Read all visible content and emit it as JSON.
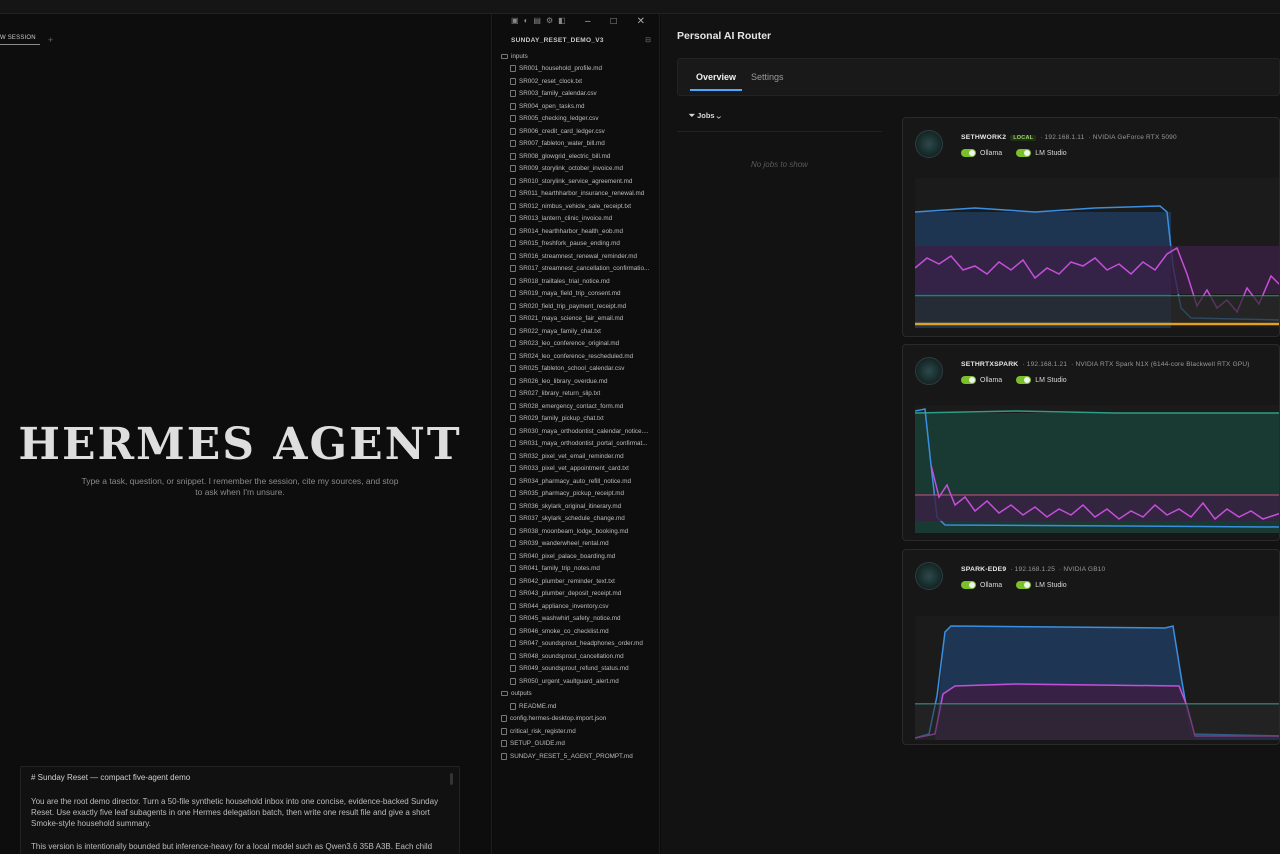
{
  "hermes": {
    "tab_label": "W SESSION",
    "tab_add": "+",
    "logo": "HERMES AGENT",
    "tagline": "Type a task, question, or snippet. I remember the session, cite my sources, and stop to ask when I'm unsure.",
    "prompt": {
      "heading": "# Sunday Reset — compact five-agent demo",
      "para1": "You are the root demo director. Turn a 50-file synthetic household inbox into one concise, evidence-backed Sunday Reset. Use exactly five leaf subagents in one Hermes delegation batch, then write one result file and give a short Smoke-style household summary.",
      "para2": "This version is intentionally bounded but inference-heavy for a local model such as Qwen3.6 35B A3B. Each child performs full"
    }
  },
  "explorer": {
    "title": "SUNDAY_RESET_DEMO_V3",
    "folder_inputs": "inputs",
    "input_files": [
      "SR001_household_profile.md",
      "SR002_reset_clock.txt",
      "SR003_family_calendar.csv",
      "SR004_open_tasks.md",
      "SR005_checking_ledger.csv",
      "SR006_credit_card_ledger.csv",
      "SR007_fableton_water_bill.md",
      "SR008_glowgrid_electric_bill.md",
      "SR009_storylink_october_invoice.md",
      "SR010_storylink_service_agreement.md",
      "SR011_hearthharbor_insurance_renewal.md",
      "SR012_nimbus_vehicle_sale_receipt.txt",
      "SR013_lantern_clinic_invoice.md",
      "SR014_hearthharbor_health_eob.md",
      "SR015_freshfork_pause_ending.md",
      "SR016_streamnest_renewal_reminder.md",
      "SR017_streamnest_cancellation_confirmatio...",
      "SR018_trailtales_trial_notice.md",
      "SR019_maya_field_trip_consent.md",
      "SR020_field_trip_payment_receipt.md",
      "SR021_maya_science_fair_email.md",
      "SR022_maya_family_chat.txt",
      "SR023_leo_conference_original.md",
      "SR024_leo_conference_rescheduled.md",
      "SR025_fableton_school_calendar.csv",
      "SR026_leo_library_overdue.md",
      "SR027_library_return_slip.txt",
      "SR028_emergency_contact_form.md",
      "SR029_family_pickup_chat.txt",
      "SR030_maya_orthodontist_calendar_notice....",
      "SR031_maya_orthodontist_portal_confirmat...",
      "SR032_pixel_vet_email_reminder.md",
      "SR033_pixel_vet_appointment_card.txt",
      "SR034_pharmacy_auto_refill_notice.md",
      "SR035_pharmacy_pickup_receipt.md",
      "SR036_skylark_original_itinerary.md",
      "SR037_skylark_schedule_change.md",
      "SR038_moonbeam_lodge_booking.md",
      "SR039_wanderwheel_rental.md",
      "SR040_pixel_palace_boarding.md",
      "SR041_family_trip_notes.md",
      "SR042_plumber_reminder_text.txt",
      "SR043_plumber_deposit_receipt.md",
      "SR044_appliance_inventory.csv",
      "SR045_washwhirl_safety_notice.md",
      "SR046_smoke_co_checklist.md",
      "SR047_soundsprout_headphones_order.md",
      "SR048_soundsprout_cancellation.md",
      "SR049_soundsprout_refund_status.md",
      "SR050_urgent_vaultguard_alert.md"
    ],
    "folder_outputs": "outputs",
    "output_files": [
      "README.md"
    ],
    "root_files": [
      "config.hermes-desktop.import.json",
      "critical_risk_register.md",
      "SETUP_GUIDE.md",
      "SUNDAY_RESET_5_AGENT_PROMPT.md"
    ]
  },
  "router": {
    "title": "Personal AI Router",
    "tabs": [
      "Overview",
      "Settings"
    ],
    "jobs_label": "Jobs",
    "empty_jobs": "No jobs to show",
    "nodes": [
      {
        "name": "SETHWORK2",
        "local_badge": "LOCAL",
        "ip": "· 192.168.1.11",
        "gpu": "· NVIDIA GeForce RTX 5090",
        "toggles": [
          "Ollama",
          "LM Studio"
        ],
        "colors": {
          "blue": "#3b8fe0",
          "magenta": "#c44fd8",
          "teal": "#3aa59a",
          "orange": "#e0a020"
        }
      },
      {
        "name": "SETHRTXSPARK",
        "local_badge": "",
        "ip": "· 192.168.1.21",
        "gpu": "· NVIDIA RTX Spark N1X (6144-core Blackwell RTX GPU)",
        "toggles": [
          "Ollama",
          "LM Studio"
        ],
        "colors": {
          "blue": "#3b8fe0",
          "magenta": "#c44fd8",
          "teal": "#2f9d86"
        }
      },
      {
        "name": "SPARK-EDE9",
        "local_badge": "",
        "ip": "· 192.168.1.25",
        "gpu": "· NVIDIA GB10",
        "toggles": [
          "Ollama",
          "LM Studio"
        ],
        "colors": {
          "blue": "#3b8fe0",
          "magenta": "#c44fd8",
          "teal": "#3aa59a"
        }
      }
    ]
  }
}
